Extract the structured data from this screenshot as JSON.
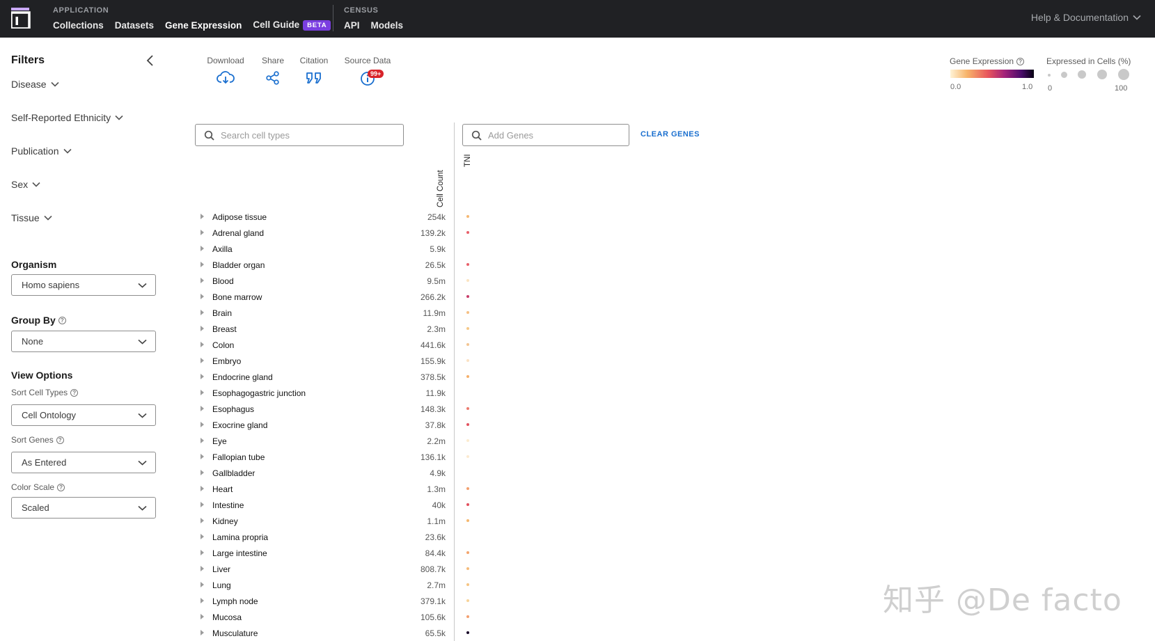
{
  "nav": {
    "app_label": "APPLICATION",
    "links": [
      "Collections",
      "Datasets",
      "Gene Expression",
      "Cell Guide"
    ],
    "beta": "BETA",
    "census_label": "CENSUS",
    "census_links": [
      "API",
      "Models"
    ],
    "help": "Help & Documentation"
  },
  "sidebar": {
    "title": "Filters",
    "filters": [
      "Disease",
      "Self-Reported Ethnicity",
      "Publication",
      "Sex",
      "Tissue"
    ],
    "organism": {
      "label": "Organism",
      "value": "Homo sapiens"
    },
    "group_by": {
      "label": "Group By",
      "value": "None"
    },
    "view_options": {
      "label": "View Options",
      "sort_cell_types": {
        "label": "Sort Cell Types",
        "value": "Cell Ontology"
      },
      "sort_genes": {
        "label": "Sort Genes",
        "value": "As Entered"
      },
      "color_scale": {
        "label": "Color Scale",
        "value": "Scaled"
      }
    }
  },
  "toolbar": {
    "download": "Download",
    "share": "Share",
    "citation": "Citation",
    "source_data": "Source Data",
    "source_badge": "99+"
  },
  "legend": {
    "gene_expression": "Gene Expression",
    "ge_min": "0.0",
    "ge_max": "1.0",
    "expressed": "Expressed in Cells (%)",
    "ex_min": "0",
    "ex_max": "100"
  },
  "search": {
    "cell_placeholder": "Search cell types",
    "gene_placeholder": "Add Genes",
    "clear": "CLEAR GENES"
  },
  "table": {
    "count_header": "Cell Count",
    "gene": "TNI",
    "rows": [
      {
        "tissue": "Adipose tissue",
        "count": "254k",
        "color": "#f5b872"
      },
      {
        "tissue": "Adrenal gland",
        "count": "139.2k",
        "color": "#e8606a"
      },
      {
        "tissue": "Axilla",
        "count": "5.9k",
        "color": ""
      },
      {
        "tissue": "Bladder organ",
        "count": "26.5k",
        "color": "#e8606a"
      },
      {
        "tissue": "Blood",
        "count": "9.5m",
        "color": "#fbe4c2"
      },
      {
        "tissue": "Bone marrow",
        "count": "266.2k",
        "color": "#c83e6a"
      },
      {
        "tissue": "Brain",
        "count": "11.9m",
        "color": "#f6c084"
      },
      {
        "tissue": "Breast",
        "count": "2.3m",
        "color": "#f6c887"
      },
      {
        "tissue": "Colon",
        "count": "441.6k",
        "color": "#f4c592"
      },
      {
        "tissue": "Embryo",
        "count": "155.9k",
        "color": "#fbe2c4"
      },
      {
        "tissue": "Endocrine gland",
        "count": "378.5k",
        "color": "#f5b06a"
      },
      {
        "tissue": "Esophagogastric junction",
        "count": "11.9k",
        "color": ""
      },
      {
        "tissue": "Esophagus",
        "count": "148.3k",
        "color": "#ec7a6e"
      },
      {
        "tissue": "Exocrine gland",
        "count": "37.8k",
        "color": "#e2525f"
      },
      {
        "tissue": "Eye",
        "count": "2.2m",
        "color": "#fcecd0"
      },
      {
        "tissue": "Fallopian tube",
        "count": "136.1k",
        "color": "#fcead0"
      },
      {
        "tissue": "Gallbladder",
        "count": "4.9k",
        "color": ""
      },
      {
        "tissue": "Heart",
        "count": "1.3m",
        "color": "#f3a06e"
      },
      {
        "tissue": "Intestine",
        "count": "40k",
        "color": "#e2505e"
      },
      {
        "tissue": "Kidney",
        "count": "1.1m",
        "color": "#f5b86f"
      },
      {
        "tissue": "Lamina propria",
        "count": "23.6k",
        "color": ""
      },
      {
        "tissue": "Large intestine",
        "count": "84.4k",
        "color": "#f4a56e"
      },
      {
        "tissue": "Liver",
        "count": "808.7k",
        "color": "#f5bb7a"
      },
      {
        "tissue": "Lung",
        "count": "2.7m",
        "color": "#f6c482"
      },
      {
        "tissue": "Lymph node",
        "count": "379.1k",
        "color": "#f8d49a"
      },
      {
        "tissue": "Mucosa",
        "count": "105.6k",
        "color": "#f3a070"
      },
      {
        "tissue": "Musculature",
        "count": "65.5k",
        "color": "#1a0a2a"
      }
    ]
  },
  "watermark": "知乎 @De facto",
  "colors": {
    "topbar": "#202124",
    "accent": "#1a6fcf",
    "beta": "#7a3ee0",
    "badge": "#d8232a"
  }
}
